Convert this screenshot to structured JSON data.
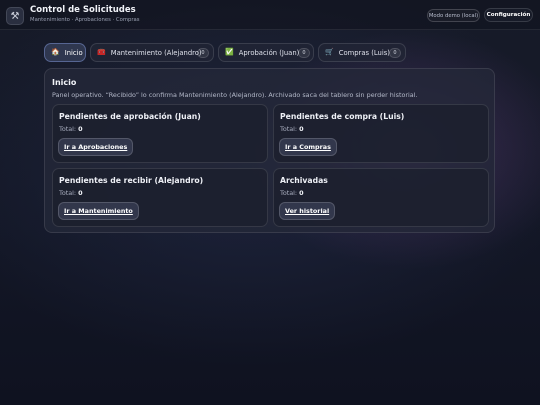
{
  "header": {
    "icon": "tools-icon",
    "title": "Control de Solicitudes",
    "subtitle": "Mantenimiento · Aprobaciones · Compras",
    "demo_label": "Modo demo (local)",
    "config_label": "Configuración"
  },
  "tabs": [
    {
      "icon": "home-icon",
      "glyph": "🏠",
      "label": "Inicio",
      "active": true
    },
    {
      "icon": "toolbox-icon",
      "glyph": "🧰",
      "label": "Mantenimiento (Alejandro)",
      "count": "0"
    },
    {
      "icon": "check-icon",
      "glyph": "✅",
      "label": "Aprobación (Juan)",
      "count": "0"
    },
    {
      "icon": "cart-icon",
      "glyph": "🛒",
      "label": "Compras (Luis)",
      "count": "0"
    }
  ],
  "panel": {
    "title": "Inicio",
    "description": "Panel operativo. “Recibido” lo confirma Mantenimiento (Alejandro). Archivado saca del tablero sin perder historial."
  },
  "cards": [
    {
      "title": "Pendientes de aprobación (Juan)",
      "total_label": "Total:",
      "total_value": "0",
      "button": "Ir a Aprobaciones"
    },
    {
      "title": "Pendientes de compra (Luis)",
      "total_label": "Total:",
      "total_value": "0",
      "button": "Ir a Compras"
    },
    {
      "title": "Pendientes de recibir (Alejandro)",
      "total_label": "Total:",
      "total_value": "0",
      "button": "Ir a Mantenimiento"
    },
    {
      "title": "Archivadas",
      "total_label": "Total:",
      "total_value": "0",
      "button": "Ver historial"
    }
  ]
}
